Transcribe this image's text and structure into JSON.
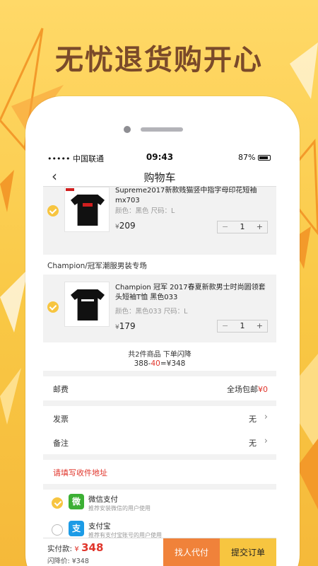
{
  "banner": {
    "headline": "无忧退货购开心"
  },
  "status_bar": {
    "carrier": "••••• 中国联通",
    "time": "09:43",
    "battery": "87%"
  },
  "nav": {
    "title": "购物车"
  },
  "items": [
    {
      "name": "Supreme2017新款贱猫竖中指字母印花短袖mx703",
      "spec": "颜色：黑色    尺码：L",
      "price_symbol": "¥",
      "price": "209",
      "qty": "1"
    },
    {
      "name": "Champion 冠军 2017春夏新款男士时尚圆领套头短袖T恤 黑色033",
      "spec": "颜色：黑色033    尺码：L",
      "price_symbol": "¥",
      "price": "179",
      "qty": "1"
    }
  ],
  "store": {
    "name": "Champion/冠军潮服男装专场"
  },
  "summary": {
    "count_text": "共2件商品 下单闪降",
    "calc_prefix": "388-",
    "calc_discount": "40",
    "calc_suffix": "=¥348"
  },
  "shipping": {
    "label": "邮费",
    "value": "全场包邮",
    "amount": "¥0"
  },
  "invoice": {
    "label": "发票",
    "value": "无"
  },
  "remark": {
    "label": "备注",
    "value": "无"
  },
  "address": {
    "prompt": "请填写收件地址"
  },
  "payments": [
    {
      "name": "微信支付",
      "desc": "推荐安装微信的用户使用",
      "icon": "wechat-icon",
      "icon_text": "微"
    },
    {
      "name": "支付宝",
      "desc": "推荐有支付宝账号的用户使用",
      "icon": "alipay-icon",
      "icon_text": "支"
    }
  ],
  "bottom": {
    "amount_label": "实付款:",
    "amount_symbol": "¥",
    "amount": "348",
    "flash_label": "闪降价: ¥348",
    "btn_friend": "找人代付",
    "btn_submit": "提交订单"
  },
  "colors": {
    "accent": "#f7c540",
    "orange": "#f0823a",
    "red": "#e0352b",
    "headline": "#7a4a2a"
  }
}
